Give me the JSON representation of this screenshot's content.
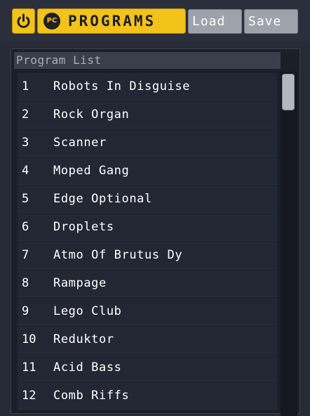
{
  "toolbar": {
    "power_icon": "power-icon",
    "pc_badge": "PC",
    "programs_label": "PROGRAMS",
    "load_label": "Load",
    "save_label": "Save",
    "accent_color": "#f3c21b",
    "button_color": "#9da2ab"
  },
  "program_list": {
    "header": "Program List",
    "items": [
      {
        "num": "1",
        "name": "Robots In Disguise"
      },
      {
        "num": "2",
        "name": "Rock Organ"
      },
      {
        "num": "3",
        "name": "Scanner"
      },
      {
        "num": "4",
        "name": "Moped Gang"
      },
      {
        "num": "5",
        "name": "Edge Optional"
      },
      {
        "num": "6",
        "name": "Droplets"
      },
      {
        "num": "7",
        "name": "Atmo Of Brutus Dy"
      },
      {
        "num": "8",
        "name": "Rampage"
      },
      {
        "num": "9",
        "name": "Lego Club"
      },
      {
        "num": "10",
        "name": "Reduktor"
      },
      {
        "num": "11",
        "name": "Acid Bass"
      },
      {
        "num": "12",
        "name": "Comb Riffs"
      }
    ]
  }
}
